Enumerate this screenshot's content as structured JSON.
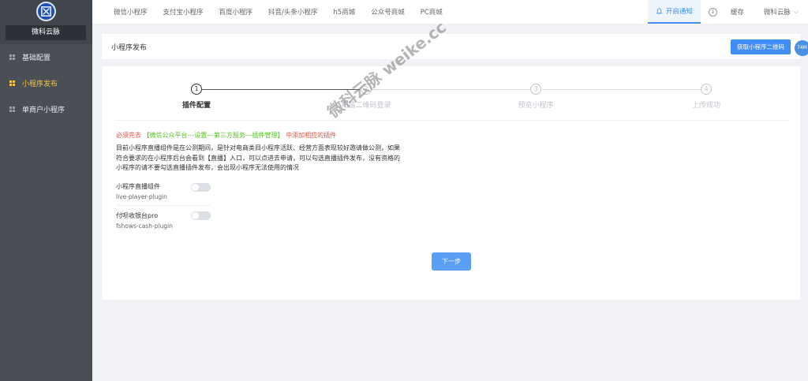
{
  "sidebar": {
    "brand": "微科云脉",
    "items": [
      {
        "label": "基础配置"
      },
      {
        "label": "小程序发布"
      },
      {
        "label": "单商户小程序"
      }
    ]
  },
  "topbar": {
    "tabs": [
      "微信小程序",
      "支付宝小程序",
      "百度小程序",
      "抖音/头条小程序",
      "h5商城",
      "公众号商城",
      "PC商城"
    ],
    "notice": "开启通知",
    "cache": "缓存",
    "user": "微科云脉"
  },
  "header": {
    "title": "小程序发布",
    "qr_button": "获取小程序二维码",
    "badge": "74M"
  },
  "steps": [
    {
      "num": "1",
      "label": "插件配置"
    },
    {
      "num": "2",
      "label": "扫描二维码登录"
    },
    {
      "num": "3",
      "label": "预览小程序"
    },
    {
      "num": "4",
      "label": "上传成功"
    }
  ],
  "notice": {
    "prefix": "必须先去",
    "path": "【微信公众平台---设置---第三方服务---插件管理】",
    "suffix": "中添加相应的插件"
  },
  "description": "目前小程序直播组件是在公测期间，是针对电商类目小程序活跃、经营方面表现较好邀请做公测，如果符合要求的在小程序后台会看到【直播】入口，可以点进去申请，可以勾选直播插件发布，没有资格的小程序的请不要勾选直播插件发布，会出现小程序无法使用的情况",
  "plugins": [
    {
      "name": "小程序直播组件",
      "id": "live-player-plugin",
      "enabled": false
    },
    {
      "name": "付呗收银台pro",
      "id": "fshows-cash-plugin",
      "enabled": false
    }
  ],
  "next_button": "下一步",
  "watermark": "微科云脉 weike.cc"
}
